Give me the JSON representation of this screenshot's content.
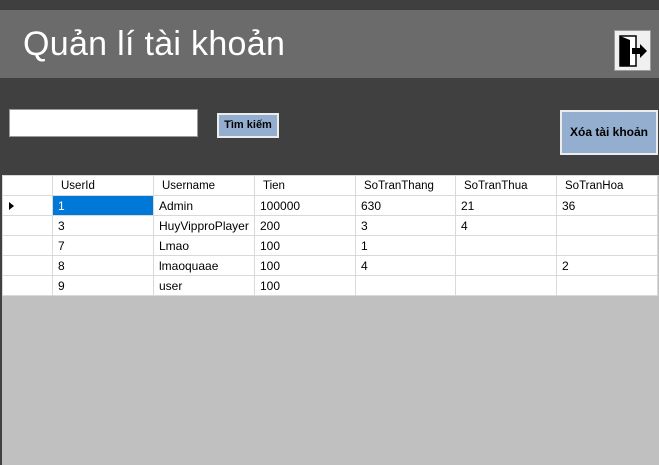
{
  "header": {
    "title": "Quản lí tài khoản",
    "exit_icon": "exit-door-icon"
  },
  "toolbar": {
    "search_value": "",
    "search_label": "Tìm kiếm",
    "delete_label": "Xóa tài khoản"
  },
  "grid": {
    "columns": [
      "UserId",
      "Username",
      "Tien",
      "SoTranThang",
      "SoTranThua",
      "SoTranHoa"
    ],
    "rows": [
      [
        "1",
        "Admin",
        "100000",
        "630",
        "21",
        "36"
      ],
      [
        "3",
        "HuyVipproPlayer",
        "200",
        "3",
        "4",
        ""
      ],
      [
        "7",
        "Lmao",
        "100",
        "1",
        "",
        ""
      ],
      [
        "8",
        "lmaoquaae",
        "100",
        "4",
        "",
        "2"
      ],
      [
        "9",
        "user",
        "100",
        "",
        "",
        ""
      ]
    ],
    "selected_row": 0
  },
  "colors": {
    "header_bg": "#6b6b6b",
    "body_bg": "#404040",
    "button_bg": "#93aecf",
    "selection": "#0078d7",
    "grid_empty_bg": "#c0c0c0"
  }
}
